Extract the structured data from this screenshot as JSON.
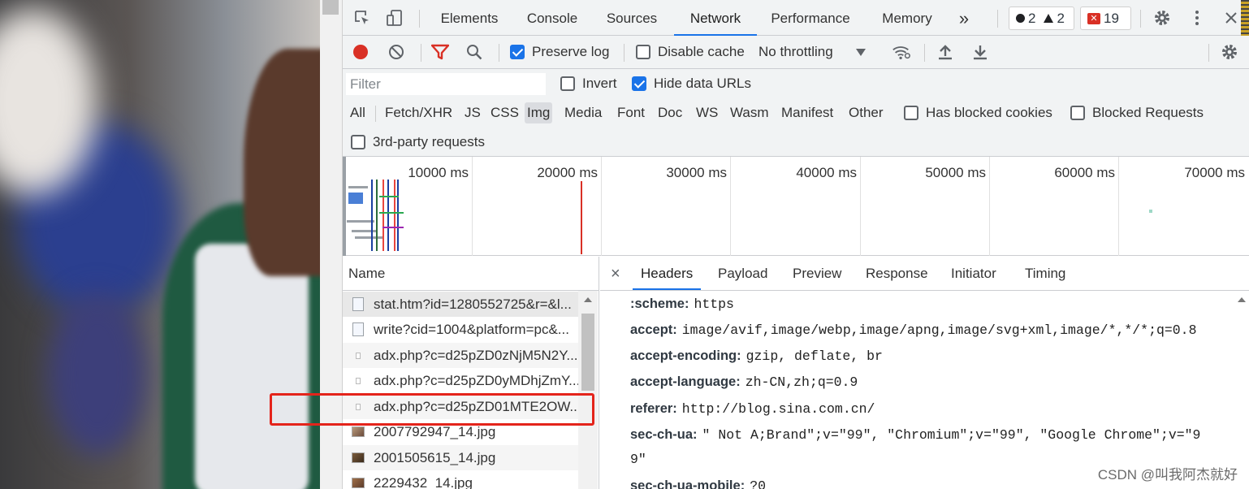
{
  "devtools": {
    "tabs": [
      "Elements",
      "Console",
      "Sources",
      "Network",
      "Performance",
      "Memory"
    ],
    "active_tab": "Network",
    "more_tabs": "»",
    "counts": {
      "errors_dot": "2",
      "warnings": "2",
      "issues": "19"
    }
  },
  "network_toolbar": {
    "preserve_log": "Preserve log",
    "preserve_log_checked": true,
    "disable_cache": "Disable cache",
    "disable_cache_checked": false,
    "throttling": "No throttling"
  },
  "filter": {
    "placeholder": "Filter",
    "invert": "Invert",
    "invert_checked": false,
    "hide_data_urls": "Hide data URLs",
    "hide_data_urls_checked": true,
    "types": [
      "All",
      "Fetch/XHR",
      "JS",
      "CSS",
      "Img",
      "Media",
      "Font",
      "Doc",
      "WS",
      "Wasm",
      "Manifest",
      "Other"
    ],
    "active_type": "Img",
    "has_blocked_cookies": "Has blocked cookies",
    "blocked_requests": "Blocked Requests",
    "third_party": "3rd-party requests"
  },
  "overview": {
    "ticks": [
      "10000 ms",
      "20000 ms",
      "30000 ms",
      "40000 ms",
      "50000 ms",
      "60000 ms",
      "70000 ms"
    ]
  },
  "requests": {
    "column": "Name",
    "rows": [
      "stat.htm?id=1280552725&r=&l...",
      "write?cid=1004&platform=pc&...",
      "adx.php?c=d25pZD0zNjM5N2Y...",
      "adx.php?c=d25pZD0yMDhjZmY...",
      "adx.php?c=d25pZD01MTE2OW...",
      "2007792947_14.jpg",
      "2001505615_14.jpg",
      "2229432_14.jpg"
    ]
  },
  "detail": {
    "close": "×",
    "tabs": [
      "Headers",
      "Payload",
      "Preview",
      "Response",
      "Initiator",
      "Timing"
    ],
    "active_tab": "Headers",
    "headers": [
      {
        "key": ":scheme:",
        "value": "https"
      },
      {
        "key": "accept:",
        "value": "image/avif,image/webp,image/apng,image/svg+xml,image/*,*/*;q=0.8"
      },
      {
        "key": "accept-encoding:",
        "value": "gzip, deflate, br"
      },
      {
        "key": "accept-language:",
        "value": "zh-CN,zh;q=0.9"
      },
      {
        "key": "referer:",
        "value": "http://blog.sina.com.cn/"
      },
      {
        "key": "sec-ch-ua:",
        "value": "\" Not A;Brand\";v=\"99\", \"Chromium\";v=\"99\", \"Google Chrome\";v=\"9"
      },
      {
        "key": "",
        "value": "9\""
      },
      {
        "key": "sec-ch-ua-mobile:",
        "value": "?0"
      }
    ]
  },
  "watermark": "CSDN @叫我阿杰就好",
  "colors": {
    "accent": "#1a73e8",
    "record": "#d93025",
    "highlight": "#e4241b"
  }
}
